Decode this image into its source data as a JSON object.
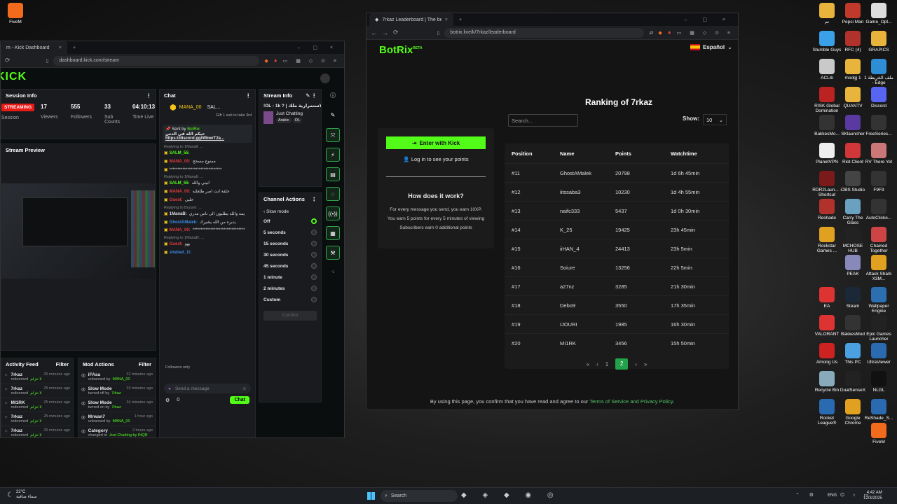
{
  "kick_window": {
    "tab_title": "m - Kick Dashboard",
    "url": "dashboard.kick.com/stream",
    "logo": "KICK",
    "session_info": {
      "title": "Session Info",
      "status": "STREAMING",
      "session_label": "Session",
      "viewers": "17",
      "viewers_label": "Viewers",
      "followers": "555",
      "followers_label": "Followers",
      "subs": "33",
      "subs_label": "Sub Counts",
      "time": "04:10:13",
      "time_label": "Time Live"
    },
    "stream_preview": {
      "title": "Stream Preview"
    },
    "chat": {
      "title": "Chat",
      "top_user": "MANA_00",
      "top_count": "1",
      "second_user": "SAL...",
      "gift_text": "Gift 1 sub to take 3rd",
      "pinned_sender": "Sent by",
      "pinned_bot": "BotRix",
      "pinned_msg": "حيكم الله في الدس",
      "pinned_link": "https://discord.gg/WbwrT2a...",
      "messages": [
        {
          "kind": "reply",
          "text": "Replying to 1Manall: ..."
        },
        {
          "kind": "msg",
          "user": "SALM_55:",
          "text": ""
        },
        {
          "kind": "msg",
          "user": "MANA_00:",
          "text": "ممنوع مسحح"
        },
        {
          "kind": "msg",
          "user": "",
          "text": "********************************"
        },
        {
          "kind": "reply",
          "text": "Replying to 1Manall: ..."
        },
        {
          "kind": "msg",
          "user": "SALM_55:",
          "text": "انيني والله"
        },
        {
          "kind": "msg",
          "user": "MANA_00:",
          "text": "حلفة انت اصر طلعلته"
        },
        {
          "kind": "msg",
          "user": "Guest:",
          "text": "حليي"
        },
        {
          "kind": "reply",
          "text": "Replying to Buusm: ..."
        },
        {
          "kind": "msg",
          "user": "1ManaB:",
          "text": "يمه والله يطلبون الى ناس مدري"
        },
        {
          "kind": "msg",
          "user": "GhostAMalek:",
          "text": "يديره من الله يشيرك"
        },
        {
          "kind": "msg",
          "user": "MANA_00:",
          "text": "********************************"
        },
        {
          "kind": "reply",
          "text": "Replying to 1ManaB: ..."
        },
        {
          "kind": "msg",
          "user": "Guest:",
          "text": "يهو"
        },
        {
          "kind": "msg",
          "user": "shahad_1i:",
          "text": ""
        }
      ],
      "followers_only": "Followers only",
      "input_placeholder": "Send a message",
      "count": "0",
      "send_label": "Chat"
    },
    "stream_info": {
      "title": "Stream Info",
      "stream_title": "!OL - 1k ? | الاستمرارية ملك",
      "category": "Just Chatting",
      "tags": [
        "Arabic",
        "OL"
      ]
    },
    "channel_actions": {
      "title": "Channel Actions",
      "sub_title": "Slow mode",
      "options": [
        "Off",
        "5 seconds",
        "15 seconds",
        "30 seconds",
        "45 seconds",
        "1 minute",
        "2 minutes",
        "Custom"
      ],
      "selected": "Off",
      "confirm_label": "Confirm"
    },
    "activity_feed": {
      "title": "Activity Feed",
      "filter_label": "Filter",
      "items": [
        {
          "user": "7rkaz",
          "action": "redeemed",
          "reward": "لا تتزلم",
          "time": "25 minutes ago"
        },
        {
          "user": "7rkaz",
          "action": "redeemed",
          "reward": "لا تتزلم",
          "time": "25 minutes ago"
        },
        {
          "user": "MI1RK",
          "action": "redeemed",
          "reward": "لا تتزلم",
          "time": "25 minutes ago"
        },
        {
          "user": "7rkaz",
          "action": "redeemed",
          "reward": "لا تتزلم",
          "time": "25 minutes ago"
        },
        {
          "user": "7rkaz",
          "action": "redeemed",
          "reward": "لا تتزلم",
          "time": "25 minutes ago"
        }
      ]
    },
    "mod_actions": {
      "title": "Mod Actions",
      "filter_label": "Filter",
      "items": [
        {
          "title": "iFAsa",
          "time": "32 minutes ago",
          "detail": "unbanned by",
          "by": "MANA_00"
        },
        {
          "title": "Slow Mode",
          "time": "33 minutes ago",
          "detail": "turned off by",
          "by": "7rkaz"
        },
        {
          "title": "Slow Mode",
          "time": "34 minutes ago",
          "detail": "turned on by",
          "by": "7rkaz"
        },
        {
          "title": "Mrwan7",
          "time": "1 hour ago",
          "detail": "unbanned by",
          "by": "MANA_00"
        },
        {
          "title": "Category",
          "time": "2 hours ago",
          "detail": "changed to",
          "by": "Just Chatting by INQR"
        }
      ]
    }
  },
  "botrix_window": {
    "tab_title": "7rkaz Leaderboard | The best Ch",
    "url": "botrix.live/k/7rkaz/leaderboard",
    "logo": "BotRix",
    "logo_badge": "BETA",
    "language": "Español",
    "heading": "Ranking of 7rkaz",
    "search_placeholder": "Search...",
    "show_label": "Show:",
    "show_value": "10",
    "enter_label": "Enter with Kick",
    "login_label": "Log in to see your points",
    "how_title": "How does it work?",
    "how_lines": [
      "For every message you send, you earn 10XP.",
      "You earn 5 points for every 5 minutes of viewing",
      "Subscribers earn 0 additional points"
    ],
    "columns": [
      "Position",
      "Name",
      "Points",
      "Watchtime"
    ],
    "rows": [
      [
        "#11",
        "GhostAMalek",
        "20798",
        "1d 6h 45min"
      ],
      [
        "#12",
        "iitssaba3",
        "10230",
        "1d 4h 55min"
      ],
      [
        "#13",
        "naifc333",
        "5437",
        "1d 0h 30min"
      ],
      [
        "#14",
        "K_25",
        "19425",
        "23h 45min"
      ],
      [
        "#15",
        "iiHAN_4",
        "24413",
        "23h 5min"
      ],
      [
        "#16",
        "Soiure",
        "13256",
        "22h 5min"
      ],
      [
        "#17",
        "a27nz",
        "3285",
        "21h 30min"
      ],
      [
        "#18",
        "Debo9",
        "3550",
        "17h 35min"
      ],
      [
        "#19",
        "IJOURI",
        "1985",
        "16h 30min"
      ],
      [
        "#20",
        "MI1RK",
        "3456",
        "15h 50min"
      ]
    ],
    "pagination": [
      "«",
      "‹",
      "1",
      "2",
      "›",
      "»"
    ],
    "current_page": "2",
    "footer_text": "By using this page, you confirm that you have read and agree to our",
    "footer_link": "Terms of Service and Privacy Policy",
    "footer_end": "."
  },
  "desktop": {
    "left_icons": [
      {
        "label": "FiveM",
        "color": "#f26a1b"
      }
    ],
    "right_icons": [
      {
        "label": "تم",
        "color": "#e8b43b"
      },
      {
        "label": "Pepsi Man",
        "color": "#c0392b"
      },
      {
        "label": "Game_Opt...",
        "color": "#ddd"
      },
      {
        "label": "Stumble Guys",
        "color": "#3aa0e8"
      },
      {
        "label": "RFC (4)",
        "color": "#b0322a"
      },
      {
        "label": "GRAPICS",
        "color": "#e8b43b"
      },
      {
        "label": "ACLib",
        "color": "#c9c9c9"
      },
      {
        "label": "modgj 1",
        "color": "#e8b43b"
      },
      {
        "label": "ملف الخريطة 1 - Edge",
        "color": "#2d8ed6"
      },
      {
        "label": "RISK Global Domination",
        "color": "#b22"
      },
      {
        "label": "QUANTV",
        "color": "#e8b43b"
      },
      {
        "label": "Discord",
        "color": "#5865f2"
      },
      {
        "label": "BakkesMo...",
        "color": "#333"
      },
      {
        "label": "SKlauncher",
        "color": "#5a3aa0"
      },
      {
        "label": "FreeSeries...",
        "color": "#333"
      },
      {
        "label": "PlanetVPN",
        "color": "#eee"
      },
      {
        "label": "Riot Client",
        "color": "#d13639"
      },
      {
        "label": "RV There Yet",
        "color": "#c77"
      },
      {
        "label": "RDR2Laun... - Shortcut",
        "color": "#7a1a1a"
      },
      {
        "label": "OBS Studio",
        "color": "#444"
      },
      {
        "label": "F9F9",
        "color": "#333"
      },
      {
        "label": "Reshade",
        "color": "#b0322a"
      },
      {
        "label": "Carry The Glass",
        "color": "#6aa0c0"
      },
      {
        "label": "AutoClicke...",
        "color": "#333"
      },
      {
        "label": "Rockstar Games ...",
        "color": "#e0a020"
      },
      {
        "label": "MCHOSE HUB",
        "color": "#222"
      },
      {
        "label": "Chained Together",
        "color": "#c44"
      },
      {
        "label": "PEAK",
        "color": "#88b"
      },
      {
        "label": "Attack Shark X3M...",
        "color": "#e0a020"
      },
      {
        "label": "EA",
        "color": "#d33"
      },
      {
        "label": "Steam",
        "color": "#1b2838"
      },
      {
        "label": "Wallpaper Engine",
        "color": "#2c6fb0"
      },
      {
        "label": "VALORANT",
        "color": "#d33"
      },
      {
        "label": "BakkesMod",
        "color": "#333"
      },
      {
        "label": "Epic Games Launcher",
        "color": "#222"
      },
      {
        "label": "Among Us",
        "color": "#c22"
      },
      {
        "label": "This PC",
        "color": "#4aa0e0"
      },
      {
        "label": "UltraViewer",
        "color": "#2a6ab0"
      },
      {
        "label": "Recycle Bin",
        "color": "#8ab"
      },
      {
        "label": "DualSenseX",
        "color": "#222"
      },
      {
        "label": "NLGL",
        "color": "#111"
      },
      {
        "label": "Rocket League®",
        "color": "#2a6ab0"
      },
      {
        "label": "Google Chrome",
        "color": "#e0a020"
      },
      {
        "label": "ReShade_S...",
        "color": "#2a6ab0"
      },
      {
        "label": "FiveM",
        "color": "#f26a1b"
      }
    ]
  },
  "taskbar": {
    "weather_temp": "22°C",
    "weather_desc": "سماء صافية",
    "search_placeholder": "Search",
    "lang": "ENG",
    "time": "4:42 AM",
    "date": "12/3/2025"
  }
}
